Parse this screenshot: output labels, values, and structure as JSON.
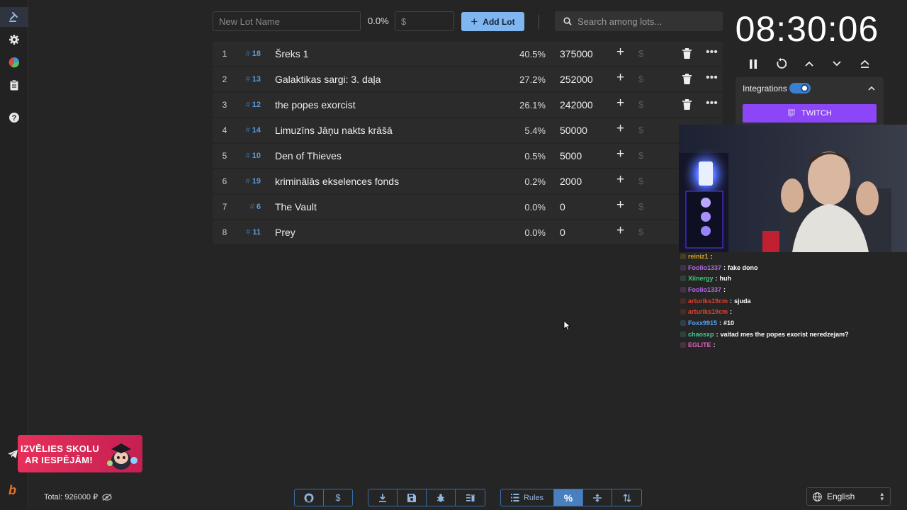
{
  "topbar": {
    "lot_name_placeholder": "New Lot Name",
    "percent": "0.0%",
    "money_placeholder": "$",
    "add_lot_label": "Add Lot",
    "search_placeholder": "Search among lots..."
  },
  "lots": [
    {
      "index": "1",
      "tag": "18",
      "name": "Šreks 1",
      "percent": "40.5%",
      "amount": "375000",
      "deletable": true
    },
    {
      "index": "2",
      "tag": "13",
      "name": "Galaktikas sargi: 3. daļa",
      "percent": "27.2%",
      "amount": "252000",
      "deletable": true
    },
    {
      "index": "3",
      "tag": "12",
      "name": "the popes exorcist",
      "percent": "26.1%",
      "amount": "242000",
      "deletable": true
    },
    {
      "index": "4",
      "tag": "14",
      "name": "Limuzīns Jāņu nakts krāšā",
      "percent": "5.4%",
      "amount": "50000",
      "deletable": false
    },
    {
      "index": "5",
      "tag": "10",
      "name": "Den of Thieves",
      "percent": "0.5%",
      "amount": "5000",
      "deletable": false
    },
    {
      "index": "6",
      "tag": "19",
      "name": "kriminālās ekselences fonds",
      "percent": "0.2%",
      "amount": "2000",
      "deletable": false
    },
    {
      "index": "7",
      "tag": "6",
      "name": "The Vault",
      "percent": "0.0%",
      "amount": "0",
      "deletable": false
    },
    {
      "index": "8",
      "tag": "11",
      "name": "Prey",
      "percent": "0.0%",
      "amount": "0",
      "deletable": false
    }
  ],
  "timer": {
    "display": "08:30:06",
    "controls": [
      "pause-icon",
      "restart-icon",
      "chevron-up-icon",
      "chevron-down-icon",
      "eject-icon"
    ]
  },
  "integrations": {
    "label": "Integrations",
    "enabled": true,
    "twitch_label": "TWITCH"
  },
  "chat": [
    {
      "user": "reiniz1",
      "color": "#d9a426",
      "text": ""
    },
    {
      "user": "Foolio1337",
      "color": "#b466e8",
      "text": "fake dono"
    },
    {
      "user": "Xiinergy",
      "color": "#3ec96f",
      "text": "huh"
    },
    {
      "user": "Foolio1337",
      "color": "#b466e8",
      "text": ""
    },
    {
      "user": "arturiks19cm",
      "color": "#e04030",
      "text": "sjuda"
    },
    {
      "user": "arturiks19cm",
      "color": "#e04030",
      "text": ""
    },
    {
      "user": "Foxx9915",
      "color": "#5aa0f0",
      "text": "#10"
    },
    {
      "user": "chaosxp",
      "color": "#46c99a",
      "text": "vaitad mes the popes exorist neredzejam?"
    },
    {
      "user": "EGLITE",
      "color": "#e060c0",
      "text": ""
    }
  ],
  "promo": {
    "line1": "IZVĒLIES SKOLU",
    "line2": "AR IESPĒJĀM!"
  },
  "footer": {
    "total": "Total: 926000 ₽",
    "rules_label": "Rules",
    "language": "English"
  },
  "colors": {
    "accent": "#7fb6f0",
    "twitch": "#8c45f7",
    "tag_blue": "#5a9ad8"
  }
}
